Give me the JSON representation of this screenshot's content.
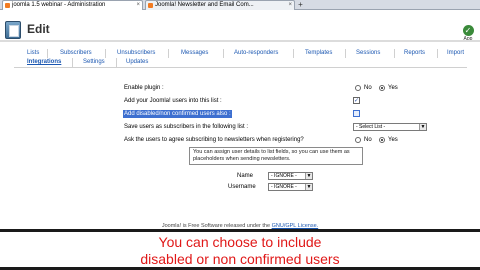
{
  "browser": {
    "tabs": [
      {
        "label": "joomla 1.5 webinar - Administration",
        "active": true
      },
      {
        "label": "Joomla! Newsletter and Email Com...",
        "active": false
      }
    ],
    "new_tab": "+"
  },
  "header": {
    "title": "Edit",
    "apply_label": "App"
  },
  "nav_tabs": [
    {
      "label": "Lists"
    },
    {
      "label": "Subscribers"
    },
    {
      "label": "Unsubscribers"
    },
    {
      "label": "Messages"
    },
    {
      "label": "Auto-responders"
    },
    {
      "label": "Templates"
    },
    {
      "label": "Sessions"
    },
    {
      "label": "Reports"
    },
    {
      "label": "Import"
    },
    {
      "label": "Integrations"
    },
    {
      "label": "Settings"
    },
    {
      "label": "Updates"
    }
  ],
  "form": {
    "enable_plugin": {
      "label": "Enable plugin :",
      "no": "No",
      "yes": "Yes",
      "value": "Yes"
    },
    "add_users": {
      "label": "Add your Joomla! users into this list :",
      "checked": true
    },
    "add_disabled": {
      "label": "Add disabled/non confirmed users also :",
      "checked": false
    },
    "save_list": {
      "label": "Save users as subscribers in the following list :",
      "value": "- Select List -"
    },
    "agree": {
      "label": "Ask the users to agree subscribing to newsletters when registering?",
      "no": "No",
      "yes": "Yes",
      "value": "Yes"
    },
    "hint": "You can assign user details to list fields, so you can use them as placeholders when sending newsletters.",
    "name_field": {
      "label": "Name",
      "value": "- IGNORE -"
    },
    "username_field": {
      "label": "Username",
      "value": "- IGNORE -"
    }
  },
  "footer": {
    "text": "Joomla! is Free Software released under the",
    "link": "GNU/GPL License."
  },
  "caption": {
    "line1": "You can choose to include",
    "line2": "disabled or non confirmed users"
  },
  "colors": {
    "caption_text": "#e01818",
    "link": "#1b57b1",
    "selection": "#3d6fd0"
  }
}
